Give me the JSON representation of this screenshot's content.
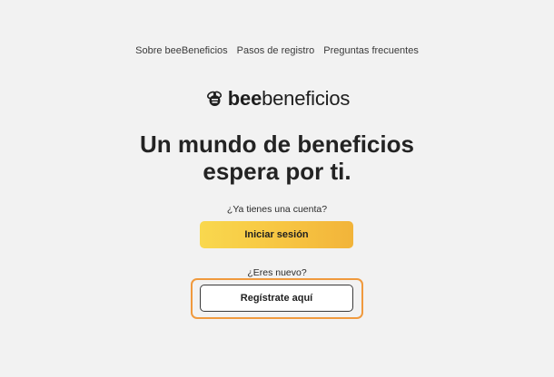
{
  "nav": {
    "items": [
      {
        "label": "Sobre beeBeneficios"
      },
      {
        "label": "Pasos de registro"
      },
      {
        "label": "Preguntas frecuentes"
      }
    ]
  },
  "logo": {
    "icon": "bee-icon",
    "bold": "bee",
    "light": "beneficios"
  },
  "hero": {
    "line1": "Un mundo de beneficios",
    "line2": "espera por ti."
  },
  "login": {
    "question": "¿Ya tienes una cuenta?",
    "button": "Iniciar sesión"
  },
  "register": {
    "question": "¿Eres nuevo?",
    "button": "Regístrate aquí"
  },
  "colors": {
    "background": "#f2f2f2",
    "login_button_start": "#f9d84e",
    "login_button_end": "#f2b43a",
    "highlight": "#f09a3e"
  }
}
